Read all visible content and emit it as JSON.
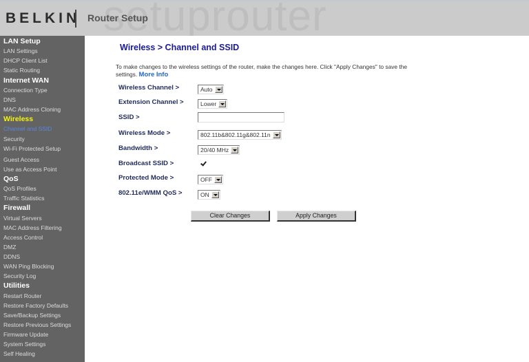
{
  "header": {
    "brand": "BELKIN",
    "app_title": "Router Setup",
    "watermark": "setuprouter"
  },
  "sidebar": {
    "sections": [
      {
        "title": "LAN Setup",
        "active": false,
        "items": [
          {
            "label": "LAN Settings"
          },
          {
            "label": "DHCP Client List"
          },
          {
            "label": "Static Routing"
          }
        ]
      },
      {
        "title": "Internet WAN",
        "active": false,
        "items": [
          {
            "label": "Connection Type"
          },
          {
            "label": "DNS"
          },
          {
            "label": "MAC Address Cloning"
          }
        ]
      },
      {
        "title": "Wireless",
        "active": true,
        "items": [
          {
            "label": "Channel and SSID",
            "active": true
          },
          {
            "label": "Security"
          },
          {
            "label": "Wi-Fi Protected Setup"
          },
          {
            "label": "Guest Access"
          },
          {
            "label": "Use as Access Point"
          }
        ]
      },
      {
        "title": "QoS",
        "active": false,
        "items": [
          {
            "label": "QoS Profiles"
          },
          {
            "label": "Traffic Statistics"
          }
        ]
      },
      {
        "title": "Firewall",
        "active": false,
        "items": [
          {
            "label": "Virtual Servers"
          },
          {
            "label": "MAC Address Filtering"
          },
          {
            "label": "Access Control"
          },
          {
            "label": "DMZ"
          },
          {
            "label": "DDNS"
          },
          {
            "label": "WAN Ping Blocking"
          },
          {
            "label": "Security Log"
          }
        ]
      },
      {
        "title": "Utilities",
        "active": false,
        "items": [
          {
            "label": "Restart Router"
          },
          {
            "label": "Restore Factory Defaults"
          },
          {
            "label": "Save/Backup Settings"
          },
          {
            "label": "Restore Previous Settings"
          },
          {
            "label": "Firmware Update"
          },
          {
            "label": "System Settings"
          },
          {
            "label": "Self Healing"
          }
        ]
      }
    ]
  },
  "main": {
    "title": "Wireless > Channel and SSID",
    "intro": "To make changes to the wireless settings of the router, make the changes here. Click \"Apply Changes\" to save the settings.",
    "more_info": "More Info",
    "form": {
      "wireless_channel": {
        "label": "Wireless Channel >",
        "value": "Auto"
      },
      "extension_channel": {
        "label": "Extension Channel >",
        "value": "Lower"
      },
      "ssid": {
        "label": "SSID >",
        "value": ""
      },
      "wireless_mode": {
        "label": "Wireless Mode >",
        "value": "802.11b&802.11g&802.11n"
      },
      "bandwidth": {
        "label": "Bandwidth >",
        "value": "20/40 MHz"
      },
      "broadcast_ssid": {
        "label": "Broadcast SSID >",
        "checked": true
      },
      "protected_mode": {
        "label": "Protected Mode >",
        "value": "OFF"
      },
      "wmm_qos": {
        "label": "802.11e/WMM QoS >",
        "value": "ON"
      }
    },
    "buttons": {
      "clear": "Clear Changes",
      "apply": "Apply Changes"
    }
  }
}
